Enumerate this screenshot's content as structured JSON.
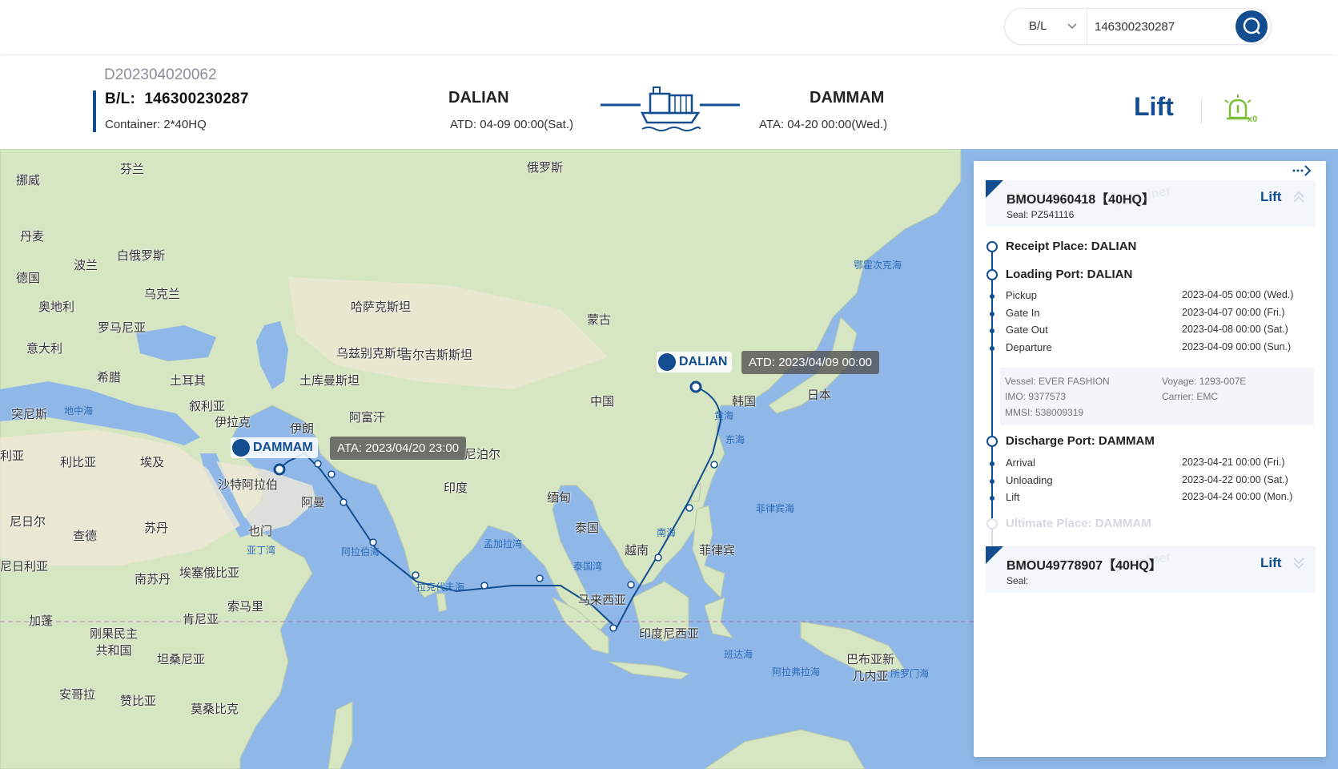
{
  "search": {
    "type_label": "B/L",
    "value": "146300230287"
  },
  "header": {
    "order_no": "D202304020062",
    "bl_label": "B/L:",
    "bl_no": "146300230287",
    "container": "Container:  2*40HQ",
    "pol": "DALIAN",
    "atd": "ATD:  04-09  00:00(Sat.)",
    "pod": "DAMMAM",
    "ata": "ATA:  04-20  00:00(Wed.)",
    "status": "Lift",
    "alarm_count": "x0"
  },
  "map": {
    "origin_name": "DALIAN",
    "origin_tip": "ATD:  2023/04/09  00:00",
    "dest_name": "DAMMAM",
    "dest_tip": "ATA:  2023/04/20  23:00",
    "labels": [
      "芬兰",
      "挪威",
      "俄罗斯",
      "丹麦",
      "波兰",
      "白俄罗斯",
      "德国",
      "乌克兰",
      "奥地利",
      "罗马尼亚",
      "意大利",
      "哈萨克斯坦",
      "蒙古",
      "乌兹别克斯坦",
      "吉尔吉斯斯坦",
      "希腊",
      "土耳其",
      "土库曼斯坦",
      "叙利亚",
      "伊拉克",
      "伊朗",
      "阿富汗",
      "突尼斯",
      "利比亚",
      "埃及",
      "沙特阿拉伯",
      "阿曼",
      "尼泊尔",
      "印度",
      "中国",
      "韩国",
      "日本",
      "缅甸",
      "泰国",
      "越南",
      "菲律宾",
      "马来西亚",
      "印度尼西亚",
      "也门",
      "苏丹",
      "尼日尔",
      "查德",
      "尼日利亚",
      "南苏丹",
      "埃塞俄比亚",
      "索马里",
      "加蓬",
      "刚果民主共和国",
      "肯尼亚",
      "坦桑尼亚",
      "安哥拉",
      "赞比亚",
      "莫桑比克",
      "巴布亚新几内亚",
      "利亚"
    ],
    "seas": [
      "鄂霍次克海",
      "黄海",
      "东海",
      "南海",
      "菲律宾海",
      "地中海",
      "亚丁湾",
      "阿拉伯海",
      "孟加拉湾",
      "拉克代夫海",
      "泰国湾",
      "班达海",
      "阿拉弗拉海",
      "所罗门海"
    ]
  },
  "panel": {
    "containers": [
      {
        "no": "BMOU4960418【40HQ】",
        "seal": "Seal: PZ541116",
        "status": "Lift",
        "watermark": "container"
      },
      {
        "no": "BMOU49778907【40HQ】",
        "seal": "Seal:",
        "status": "Lift",
        "watermark": "container"
      }
    ],
    "receipt": "Receipt Place:  DALIAN",
    "loading": "Loading Port:  DALIAN",
    "loading_events": [
      {
        "name": "Pickup",
        "time": "2023-04-05 00:00 (Wed.)"
      },
      {
        "name": "Gate In",
        "time": "2023-04-07 00:00 (Fri.)"
      },
      {
        "name": "Gate Out",
        "time": "2023-04-08 00:00 (Sat.)"
      },
      {
        "name": "Departure",
        "time": "2023-04-09 00:00 (Sun.)"
      }
    ],
    "vessel": "Vessel:  EVER FASHION",
    "voyage": "Voyage:  1293-007E",
    "imo": "IMO: 9377573",
    "carrier": "Carrier:  EMC",
    "mmsi": "MMSI: 538009319",
    "discharge": "Discharge Port:  DAMMAM",
    "discharge_events": [
      {
        "name": "Arrival",
        "time": "2023-04-21 00:00 (Fri.)"
      },
      {
        "name": "Unloading",
        "time": "2023-04-22 00:00 (Sat.)"
      },
      {
        "name": "Lift",
        "time": "2023-04-24 00:00 (Mon.)"
      }
    ],
    "ultimate": "Ultimate Place:  DAMMAM"
  },
  "colors": {
    "brand": "#124d8f",
    "alarm": "#7bbf3a"
  }
}
